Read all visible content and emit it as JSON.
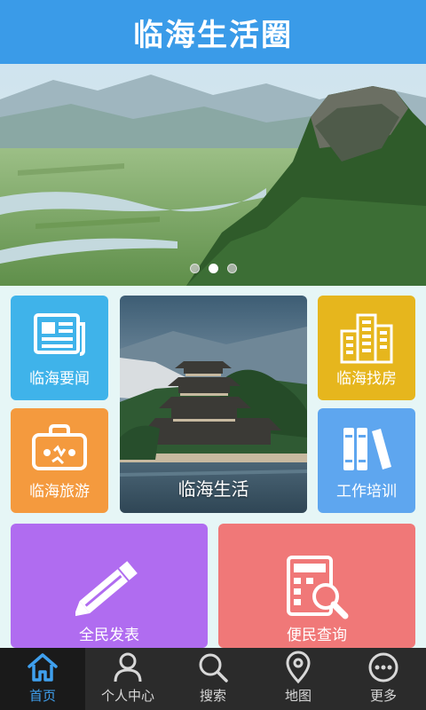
{
  "header": {
    "title": "临海生活圈"
  },
  "banner": {
    "slides": 3,
    "active_index": 1
  },
  "tiles": {
    "news": {
      "label": "临海要闻",
      "icon": "newspaper-icon",
      "color": "#3fb3ea"
    },
    "travel": {
      "label": "临海旅游",
      "icon": "suitcase-icon",
      "color": "#f49a3e"
    },
    "life": {
      "label": "临海生活"
    },
    "house": {
      "label": "临海找房",
      "icon": "buildings-icon",
      "color": "#e6b61d"
    },
    "training": {
      "label": "工作培训",
      "icon": "books-icon",
      "color": "#5ea6ef"
    },
    "post": {
      "label": "全民发表",
      "icon": "pencil-icon",
      "color": "#b06cf0"
    },
    "query": {
      "label": "便民查询",
      "icon": "calculator-search-icon",
      "color": "#f07878"
    }
  },
  "nav": {
    "items": [
      {
        "label": "首页",
        "icon": "home-icon",
        "active": true
      },
      {
        "label": "个人中心",
        "icon": "user-icon",
        "active": false
      },
      {
        "label": "搜索",
        "icon": "search-icon",
        "active": false
      },
      {
        "label": "地图",
        "icon": "map-pin-icon",
        "active": false
      },
      {
        "label": "更多",
        "icon": "more-icon",
        "active": false
      }
    ],
    "active_color": "#3fa0ee"
  }
}
